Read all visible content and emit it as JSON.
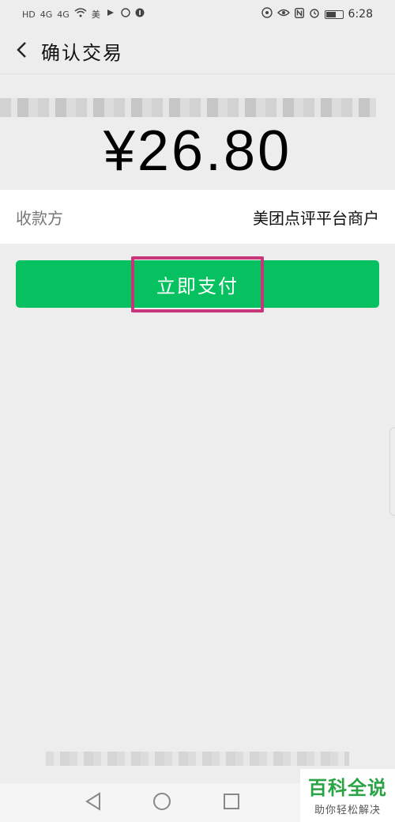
{
  "status_bar": {
    "network_left": "HD",
    "signal_1": "4G",
    "signal_2": "4G",
    "meituan_label": "美",
    "time": "6:28"
  },
  "header": {
    "title": "确认交易"
  },
  "payment": {
    "amount": "¥26.80",
    "payee_label": "收款方",
    "payee_value": "美团点评平台商户"
  },
  "actions": {
    "pay_label": "立即支付"
  },
  "watermark": {
    "main": "百科全说",
    "sub": "助你轻松解决"
  },
  "colors": {
    "accent_green": "#07c160",
    "highlight_box": "#c7357b"
  }
}
